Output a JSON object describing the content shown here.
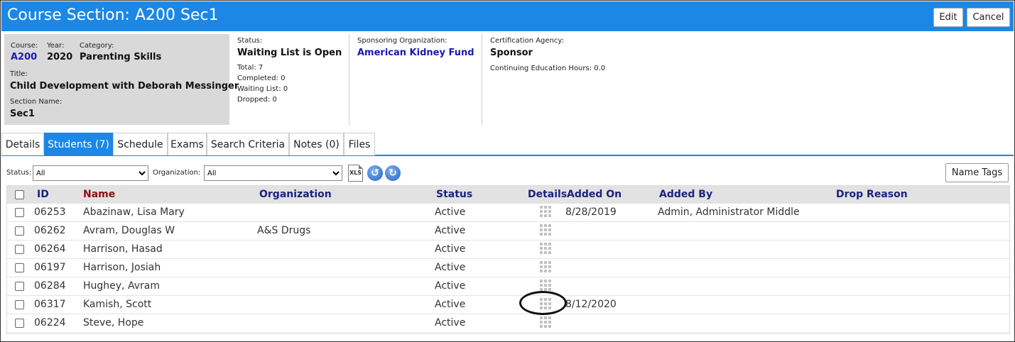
{
  "header": {
    "title": "Course Section: A200 Sec1",
    "edit_label": "Edit",
    "cancel_label": "Cancel"
  },
  "info": {
    "course_label": "Course:",
    "course_value": "A200",
    "year_label": "Year:",
    "year_value": "2020",
    "category_label": "Category:",
    "category_value": "Parenting Skills",
    "title_label": "Title:",
    "title_value": "Child Development with Deborah Messinger",
    "section_label": "Section Name:",
    "section_value": "Sec1",
    "status_label": "Status:",
    "status_value": "Waiting List is Open",
    "total": "Total: 7",
    "completed": "Completed: 0",
    "waiting": "Waiting List: 0",
    "dropped": "Dropped: 0",
    "sponsor_label": "Sponsoring Organization:",
    "sponsor_value": "American Kidney Fund",
    "cert_label": "Certification Agency:",
    "cert_value": "Sponsor",
    "ce_hours": "Continuing Education Hours: 0.0"
  },
  "tabs": [
    "Details",
    "Students (7)",
    "Schedule",
    "Exams",
    "Search Criteria",
    "Notes (0)",
    "Files"
  ],
  "filters": {
    "status_label": "Status:",
    "status_value": "All",
    "org_label": "Organization:",
    "org_value": "All",
    "xls_label": "XLS",
    "name_tags_label": "Name Tags"
  },
  "table": {
    "columns": [
      "ID",
      "Name",
      "Organization",
      "Status",
      "Details",
      "Added On",
      "Added By",
      "Drop Reason"
    ],
    "rows": [
      {
        "id": "06253",
        "name": "Abazinaw, Lisa Mary",
        "org": "",
        "status": "Active",
        "added_on": "8/28/2019",
        "added_by": "Admin, Administrator Middle"
      },
      {
        "id": "06262",
        "name": "Avram, Douglas W",
        "org": "A&S Drugs",
        "status": "Active",
        "added_on": "",
        "added_by": ""
      },
      {
        "id": "06264",
        "name": "Harrison, Hasad",
        "org": "",
        "status": "Active",
        "added_on": "",
        "added_by": ""
      },
      {
        "id": "06197",
        "name": "Harrison, Josiah",
        "org": "",
        "status": "Active",
        "added_on": "",
        "added_by": ""
      },
      {
        "id": "06284",
        "name": "Hughey, Avram",
        "org": "",
        "status": "Active",
        "added_on": "",
        "added_by": ""
      },
      {
        "id": "06317",
        "name": "Kamish, Scott",
        "org": "",
        "status": "Active",
        "added_on": "8/12/2020",
        "added_by": ""
      },
      {
        "id": "06224",
        "name": "Steve, Hope",
        "org": "",
        "status": "Active",
        "added_on": "",
        "added_by": ""
      }
    ]
  },
  "colors": {
    "accent": "#1b87e6",
    "header_text": "#1a237e",
    "name_header": "#8b1010",
    "link": "#1a1ab0"
  }
}
